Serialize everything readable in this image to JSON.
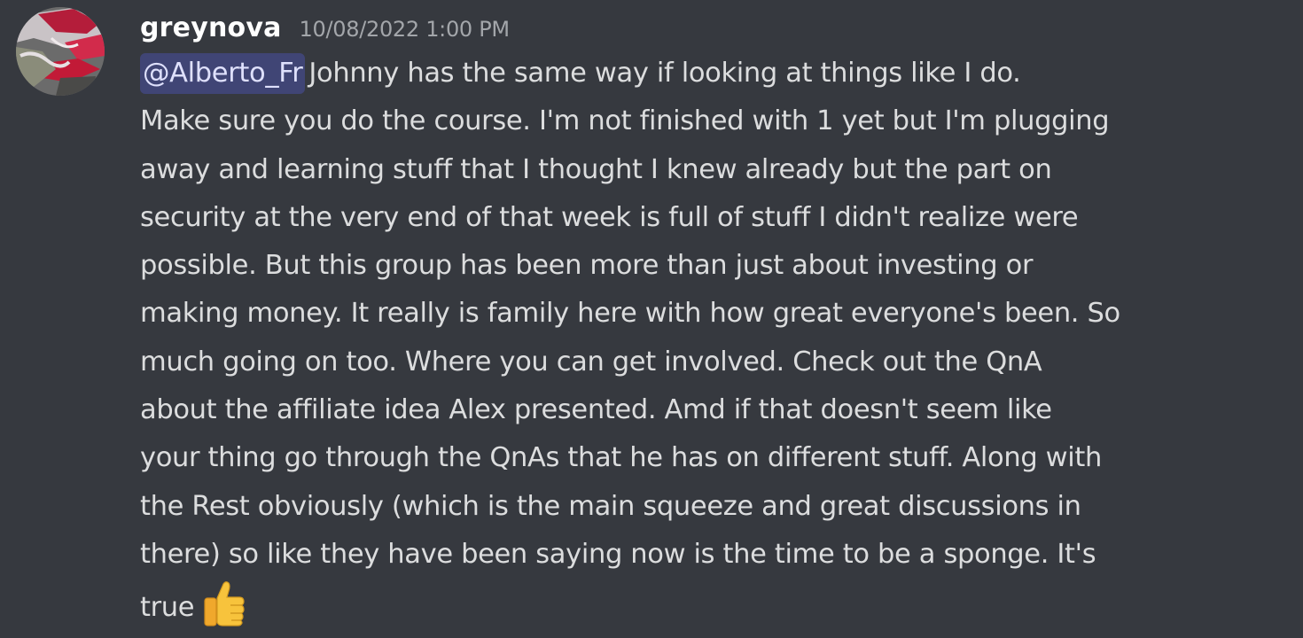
{
  "message": {
    "author": "greynova",
    "timestamp": "10/08/2022 1:00 PM",
    "mention": "@Alberto_Fr",
    "lines": [
      "Johnny has the same way if looking at things like I do.",
      "Make sure you do the course. I'm not finished with 1 yet but I'm plugging",
      "away and learning stuff that I thought I knew already but the part on",
      "security at the very end of that week is full of stuff I didn't realize were",
      "possible. But this group has been more than just about investing or",
      "making money. It really is family here with how great everyone's been. So",
      "much going on too. Where you can get involved. Check out the QnA",
      "about the affiliate idea Alex presented. Amd if that doesn't seem like",
      "your thing go through the QnAs that he has on different stuff. Along with",
      "the Rest obviously (which is the main squeeze and great discussions in",
      "there) so like they have been saying now is the time to be a sponge. It's",
      "true"
    ],
    "emoji": "thumbs-up-icon"
  },
  "colors": {
    "background": "#36393f",
    "username": "#ffffff",
    "timestamp": "#a3a6aa",
    "text": "#dcddde",
    "mention_bg": "#4b4f8a",
    "mention_text": "#dee0fc",
    "emoji": "#f7c33c"
  }
}
